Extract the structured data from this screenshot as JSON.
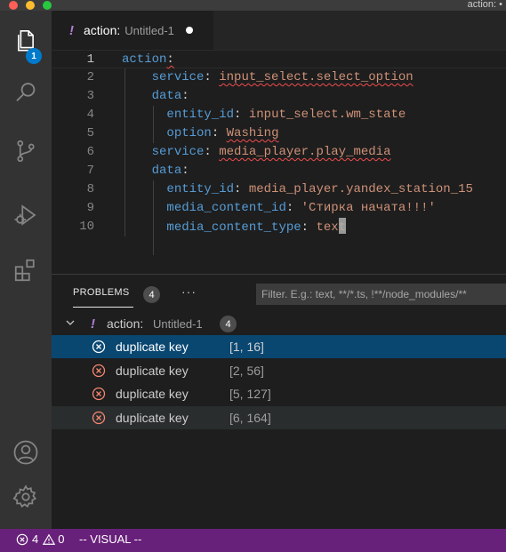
{
  "window": {
    "title": "action: •"
  },
  "activity_bar": {
    "items": [
      "explorer",
      "search",
      "source-control",
      "run-debug",
      "extensions",
      "accounts",
      "manage"
    ],
    "explorer_badge": "1",
    "colors": {
      "background": "#333333",
      "icon": "#858585",
      "active_icon": "#ffffff",
      "badge": "#007acc"
    }
  },
  "tab": {
    "marker": "!",
    "name": "action:",
    "description": "Untitled-1",
    "dirty": true
  },
  "editor": {
    "lines": [
      {
        "n": "1",
        "indent": "",
        "key": "action",
        "sep": ":",
        "value": ""
      },
      {
        "n": "2",
        "indent": "    ",
        "key": "service",
        "sep": ": ",
        "value": "input_select.select_option"
      },
      {
        "n": "3",
        "indent": "    ",
        "key": "data",
        "sep": ":",
        "value": ""
      },
      {
        "n": "4",
        "indent": "      ",
        "key": "entity_id",
        "sep": ": ",
        "value": "input_select.wm_state"
      },
      {
        "n": "5",
        "indent": "      ",
        "key": "option",
        "sep": ": ",
        "value": "Washing"
      },
      {
        "n": "6",
        "indent": "    ",
        "key": "service",
        "sep": ": ",
        "value": "media_player.play_media"
      },
      {
        "n": "7",
        "indent": "    ",
        "key": "data",
        "sep": ":",
        "value": ""
      },
      {
        "n": "8",
        "indent": "      ",
        "key": "entity_id",
        "sep": ": ",
        "value": "media_player.yandex_station_15"
      },
      {
        "n": "9",
        "indent": "      ",
        "key": "media_content_id",
        "sep": ": ",
        "value": "'Стирка начата!!!'"
      },
      {
        "n": "10",
        "indent": "      ",
        "key": "media_content_type",
        "sep": ": ",
        "value": "text"
      }
    ],
    "colors": {
      "key": "#569cd6",
      "string": "#ce9178",
      "error_squiggle": "#f14c4c"
    }
  },
  "panel": {
    "tab_label": "PROBLEMS",
    "problem_count": "4",
    "more_label": "···",
    "filter_placeholder": "Filter. E.g.: text, **/*.ts, !**/node_modules/**",
    "file": {
      "marker": "!",
      "name": "action:",
      "description": "Untitled-1",
      "count": "4"
    },
    "problems": [
      {
        "message": "duplicate key",
        "position": "[1, 16]"
      },
      {
        "message": "duplicate key",
        "position": "[2, 56]"
      },
      {
        "message": "duplicate key",
        "position": "[5, 127]"
      },
      {
        "message": "duplicate key",
        "position": "[6, 164]"
      }
    ]
  },
  "status_bar": {
    "errors": "4",
    "warnings": "0",
    "mode": "-- VISUAL --",
    "colors": {
      "background": "#68217a"
    }
  }
}
